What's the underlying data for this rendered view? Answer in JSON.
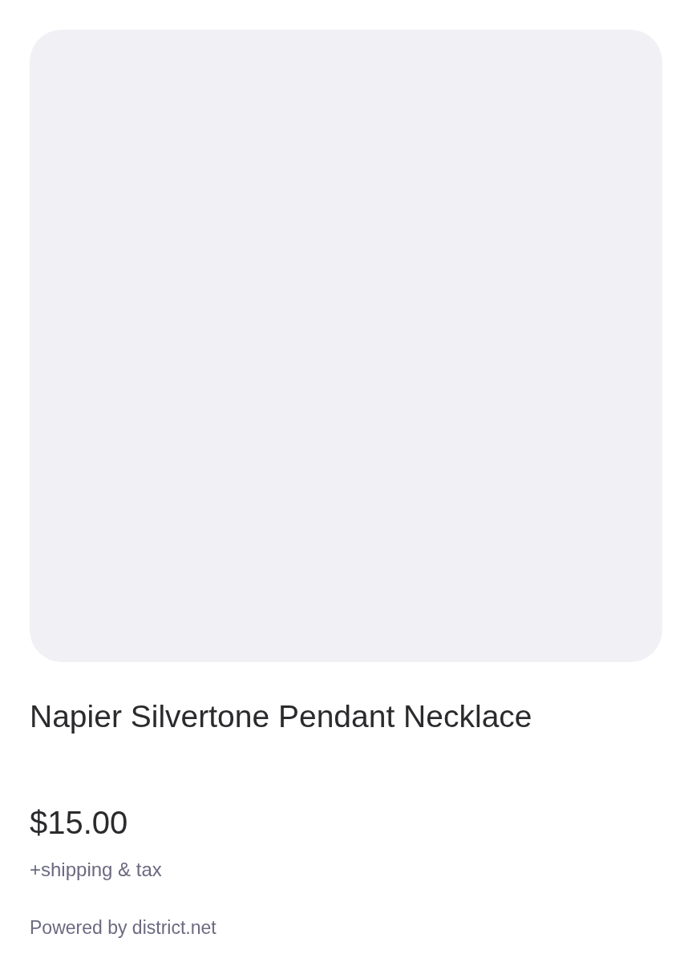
{
  "product": {
    "title": "Napier Silvertone Pendant Necklace",
    "price": "$15.00",
    "price_note": "+shipping & tax"
  },
  "footer": {
    "text": "Powered by district.net"
  }
}
